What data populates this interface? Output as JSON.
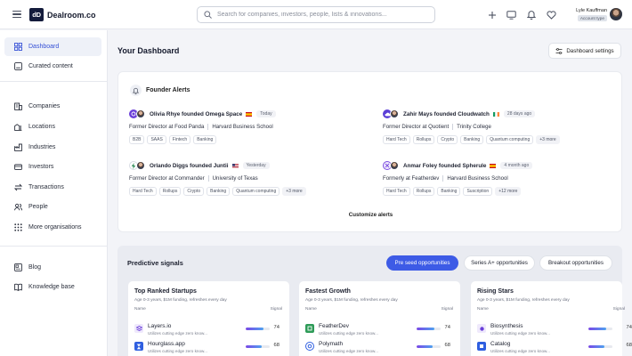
{
  "app": {
    "logo_mark": "dD",
    "name": "Dealroom.co"
  },
  "search": {
    "placeholder": "Search for companies, investors, people, lists & innovations..."
  },
  "header_icons": [
    "plus-icon",
    "monitor-icon",
    "bell-icon",
    "heart-icon"
  ],
  "user": {
    "name": "Lyle Kauffman",
    "badge": "Account type"
  },
  "sidebar": {
    "top": [
      {
        "label": "Dashboard",
        "icon": "dashboard-icon",
        "active": true
      },
      {
        "label": "Curated content",
        "icon": "curated-icon",
        "active": false
      }
    ],
    "middle": [
      {
        "label": "Companies",
        "icon": "companies-icon"
      },
      {
        "label": "Locations",
        "icon": "locations-icon"
      },
      {
        "label": "Industries",
        "icon": "industries-icon"
      },
      {
        "label": "Investors",
        "icon": "investors-icon"
      },
      {
        "label": "Transactions",
        "icon": "transactions-icon"
      },
      {
        "label": "People",
        "icon": "people-icon"
      },
      {
        "label": "More organisations",
        "icon": "more-icon"
      }
    ],
    "bottom": [
      {
        "label": "Blog",
        "icon": "blog-icon"
      },
      {
        "label": "Knowledge base",
        "icon": "knowledge-icon"
      }
    ]
  },
  "page": {
    "title": "Your Dashboard",
    "settings_label": "Dashboard settings"
  },
  "founder_alerts": {
    "title": "Founder Alerts",
    "customize_label": "Customize alerts",
    "alerts": [
      {
        "title": "Olivia Rhye founded Omega Space",
        "flag": "spain",
        "time": "Today",
        "role": "Former Director at Food Panda",
        "school": "Harvard Business School",
        "tags": [
          "B2B",
          "SAAS",
          "Fintech",
          "Banking"
        ],
        "logo_color": "#6a3fd9"
      },
      {
        "title": "Zahir Mays founded Cloudwatch",
        "flag": "ireland",
        "time": "28 days ago",
        "role": "Former Director at Quotient",
        "school": "Trinity College",
        "tags": [
          "Hard Tech",
          "Rollups",
          "Crypto",
          "Banking",
          "Quantum computing",
          "+3 more"
        ],
        "logo_color": "#5b3fd6"
      },
      {
        "title": "Orlando Diggs founded Juntii",
        "flag": "usa",
        "time": "Yesterday",
        "role": "Former Director at Commander",
        "school": "University of Texas",
        "tags": [
          "Hard Tech",
          "Rollups",
          "Crypto",
          "Banking",
          "Quantum computing",
          "+3 more"
        ],
        "logo_color": "#2e8b57"
      },
      {
        "title": "Anmar Foley founded Spherule",
        "flag": "spain",
        "time": "4 month ago",
        "role": "Formerly at Featherdev",
        "school": "Harvard Business School",
        "tags": [
          "Hard Tech",
          "Rollups",
          "Banking",
          "Suscription",
          "+12 more"
        ],
        "logo_color": "#7b4de0"
      }
    ]
  },
  "predictive_signals": {
    "title": "Predictive signals",
    "filters": [
      {
        "label": "Pre seed opportunities",
        "active": true
      },
      {
        "label": "Series A+ opportunities",
        "active": false
      },
      {
        "label": "Breakout opportunities",
        "active": false
      }
    ],
    "columns": [
      {
        "title": "Top Ranked Startups",
        "subtitle": "Age 0-3 years, $1M funding, refreshes every day",
        "col_name": "Name",
        "col_signal": "Signal",
        "rows": [
          {
            "name": "Layers.io",
            "desc": "Utilizes cutting edge zero know...",
            "signal": 74,
            "logo_color": "#6a3fd9"
          },
          {
            "name": "Hourglass.app",
            "desc": "Utilizes cutting edge zero know...",
            "signal": 68,
            "logo_color": "#2f5fe0"
          }
        ]
      },
      {
        "title": "Fastest Growth",
        "subtitle": "Age 0-3 years, $1M funding, refreshes every day",
        "col_name": "Name",
        "col_signal": "Signal",
        "rows": [
          {
            "name": "FeatherDev",
            "desc": "Utilizes cutting edge zero know...",
            "signal": 74,
            "logo_color": "#2e9b58"
          },
          {
            "name": "Polymath",
            "desc": "Utilizes cutting edge zero know...",
            "signal": 68,
            "logo_color": "#2f5fe0"
          }
        ]
      },
      {
        "title": "Rising Stars",
        "subtitle": "Age 0-3 years, $1M funding, refreshes every day",
        "col_name": "Name",
        "col_signal": "Signal",
        "rows": [
          {
            "name": "Biosynthesis",
            "desc": "Utilizes cutting edge zero know...",
            "signal": 74,
            "logo_color": "#6a3fd9"
          },
          {
            "name": "Catalog",
            "desc": "Utilizes cutting edge zero know...",
            "signal": 68,
            "logo_color": "#2f5fe0"
          }
        ]
      }
    ]
  },
  "colors": {
    "accent": "#3d5be6",
    "sidebar_active_bg": "#eef1f8",
    "panel_bg": "#e9ebf1"
  }
}
